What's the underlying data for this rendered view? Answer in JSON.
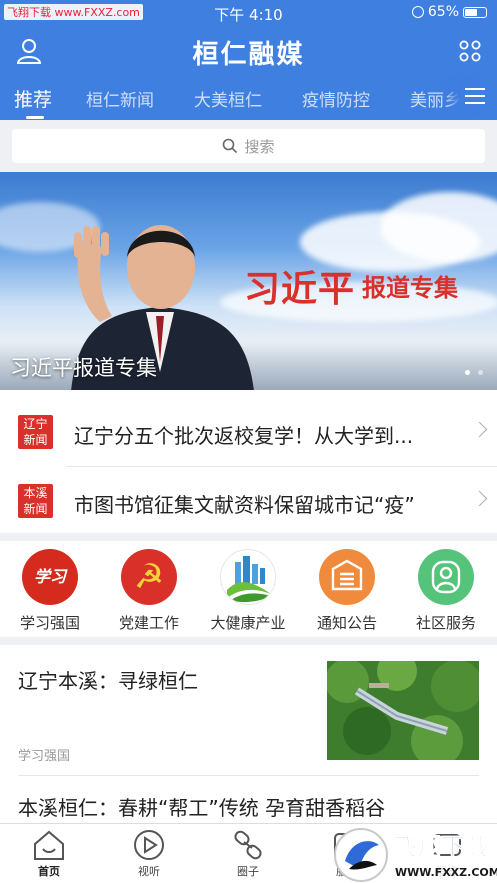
{
  "status_bar": {
    "site_label": "飞翔下载 www.FXXZ.com",
    "time": "下午 4:10",
    "battery": "65%",
    "battery_level": 0.65
  },
  "header": {
    "app_title": "桓仁融媒"
  },
  "tabs": [
    {
      "label": "推荐",
      "active": true
    },
    {
      "label": "桓仁新闻"
    },
    {
      "label": "大美桓仁"
    },
    {
      "label": "疫情防控"
    },
    {
      "label": "美丽乡"
    }
  ],
  "search": {
    "placeholder": "搜索"
  },
  "banner": {
    "headline": "习近平",
    "subheadline": "报道专集",
    "caption": "习近平报道专集",
    "slide_count": 2,
    "active_slide": 1
  },
  "news": [
    {
      "badge_line1": "辽宁",
      "badge_line2": "新闻",
      "title": "辽宁分五个批次返校复学！从大学到..."
    },
    {
      "badge_line1": "本溪",
      "badge_line2": "新闻",
      "title": "市图书馆征集文献资料保留城市记“疫”"
    }
  ],
  "services": [
    {
      "label": "学习强国",
      "icon": "xuexi-qiangguo-icon",
      "color": "#d52b1e",
      "glyph": "学习"
    },
    {
      "label": "党建工作",
      "icon": "party-emblem-icon",
      "color": "#d9312a",
      "glyph": "☭"
    },
    {
      "label": "大健康产业",
      "icon": "city-leaf-icon",
      "color": "#4aa3df"
    },
    {
      "label": "通知公告",
      "icon": "notice-board-icon",
      "color": "#f08a3c"
    },
    {
      "label": "社区服务",
      "icon": "community-icon",
      "color": "#55c47a"
    }
  ],
  "articles": [
    {
      "title": "辽宁本溪：寻绿桓仁",
      "source": "学习强国"
    },
    {
      "title": "本溪桓仁：春耕“帮工”传统 孕育甜香稻谷"
    }
  ],
  "tabbar": [
    {
      "label": "首页",
      "icon": "home-icon",
      "active": true
    },
    {
      "label": "视听",
      "icon": "play-icon"
    },
    {
      "label": "圈子",
      "icon": "link-icon"
    },
    {
      "label": "服务",
      "icon": "service-icon"
    },
    {
      "label": "消息",
      "icon": "message-icon"
    }
  ],
  "watermark": {
    "text": "飞翔下载",
    "url": "WWW.FXXZ.COM"
  },
  "colors": {
    "brand_blue": "#3f7fe0",
    "badge_red": "#d9312a"
  }
}
